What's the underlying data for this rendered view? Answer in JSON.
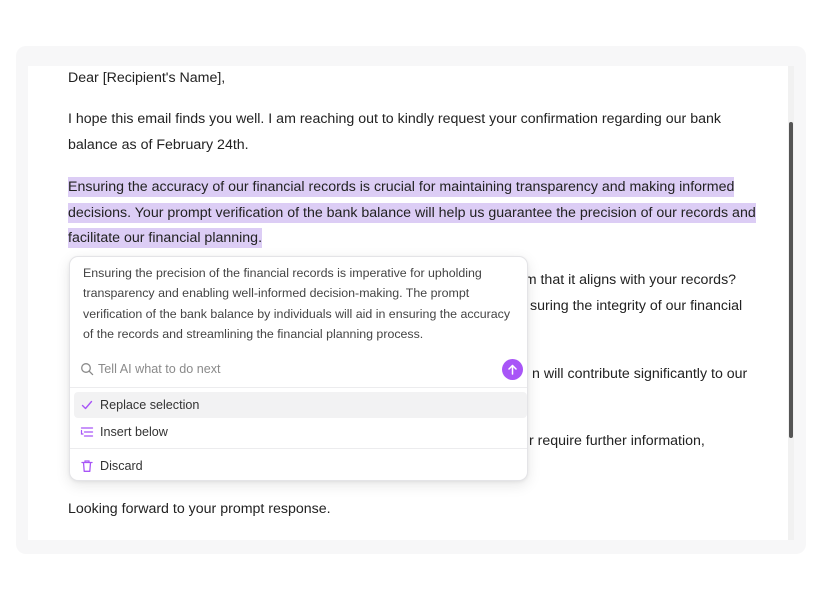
{
  "document": {
    "greeting": "Dear [Recipient's Name],",
    "paragraph_1": "I hope this email finds you well. I am reaching out to kindly request your confirmation regarding our bank balance as of February 24th.",
    "paragraph_2_selected": "Ensuring the accuracy of our financial records is crucial for maintaining transparency and making informed decisions. Your prompt verification of the bank balance will help us guarantee the precision of our records and facilitate our financial planning.",
    "occluded_fragment_1": "rm that it aligns with your records?",
    "occluded_fragment_2": "suring the integrity of our financial",
    "occluded_fragment_3": "n will contribute significantly to our",
    "occluded_fragment_4": "r require further information,",
    "closing": "Looking forward to your prompt response."
  },
  "ai_panel": {
    "suggestion": "Ensuring the precision of the financial records is imperative for upholding transparency and enabling well-informed decision-making. The prompt verification of the bank balance by individuals will aid in ensuring the accuracy of the records and streamlining the financial planning process.",
    "input_placeholder": "Tell AI what to do next",
    "input_value": "",
    "actions": [
      {
        "label": "Replace selection",
        "icon": "check-icon",
        "active": true
      },
      {
        "label": "Insert below",
        "icon": "insert-below-icon",
        "active": false
      },
      {
        "label": "Discard",
        "icon": "trash-icon",
        "active": false
      }
    ]
  },
  "colors": {
    "selection_highlight": "#dccdf5",
    "accent": "#a855f7",
    "text": "#222222"
  }
}
